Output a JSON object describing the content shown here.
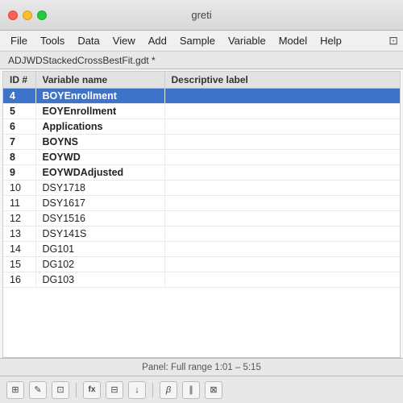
{
  "window": {
    "title": "greti"
  },
  "menubar": {
    "items": [
      "File",
      "Tools",
      "Data",
      "View",
      "Add",
      "Sample",
      "Variable",
      "Model",
      "Help"
    ]
  },
  "file_tab": {
    "label": "ADJWDStackedCrossBestFit.gdt *"
  },
  "table": {
    "headers": [
      "ID #",
      "Variable name",
      "Descriptive label"
    ],
    "rows": [
      {
        "id": "4",
        "varname": "BOYEnrollment",
        "label": "",
        "selected": true
      },
      {
        "id": "5",
        "varname": "EOYEnrollment",
        "label": "",
        "selected": false
      },
      {
        "id": "6",
        "varname": "Applications",
        "label": "",
        "selected": false
      },
      {
        "id": "7",
        "varname": "BOYNS",
        "label": "",
        "selected": false
      },
      {
        "id": "8",
        "varname": "EOYWD",
        "label": "",
        "selected": false
      },
      {
        "id": "9",
        "varname": "EOYWDAdjusted",
        "label": "",
        "selected": false
      },
      {
        "id": "10",
        "varname": "DSY1718",
        "label": "",
        "selected": false
      },
      {
        "id": "11",
        "varname": "DSY1617",
        "label": "",
        "selected": false
      },
      {
        "id": "12",
        "varname": "DSY1516",
        "label": "",
        "selected": false
      },
      {
        "id": "13",
        "varname": "DSY141S",
        "label": "",
        "selected": false
      },
      {
        "id": "14",
        "varname": "DG101",
        "label": "",
        "selected": false
      },
      {
        "id": "15",
        "varname": "DG102",
        "label": "",
        "selected": false
      },
      {
        "id": "16",
        "varname": "DG103",
        "label": "",
        "selected": false
      }
    ]
  },
  "status": {
    "panel_label": "Panel: Full range 1:01 – 5:15"
  },
  "bottom_toolbar": {
    "buttons": [
      {
        "icon": "⊞",
        "name": "grid-icon"
      },
      {
        "icon": "✎",
        "name": "edit-icon"
      },
      {
        "icon": "⊡",
        "name": "box-icon"
      },
      {
        "icon": "fx",
        "name": "fx-icon"
      },
      {
        "icon": "≡",
        "name": "list-icon"
      },
      {
        "icon": "↓",
        "name": "down-icon"
      },
      {
        "icon": "β",
        "name": "beta-icon"
      },
      {
        "icon": "∥",
        "name": "parallel-icon"
      },
      {
        "icon": "⊠",
        "name": "cross-icon"
      }
    ]
  }
}
